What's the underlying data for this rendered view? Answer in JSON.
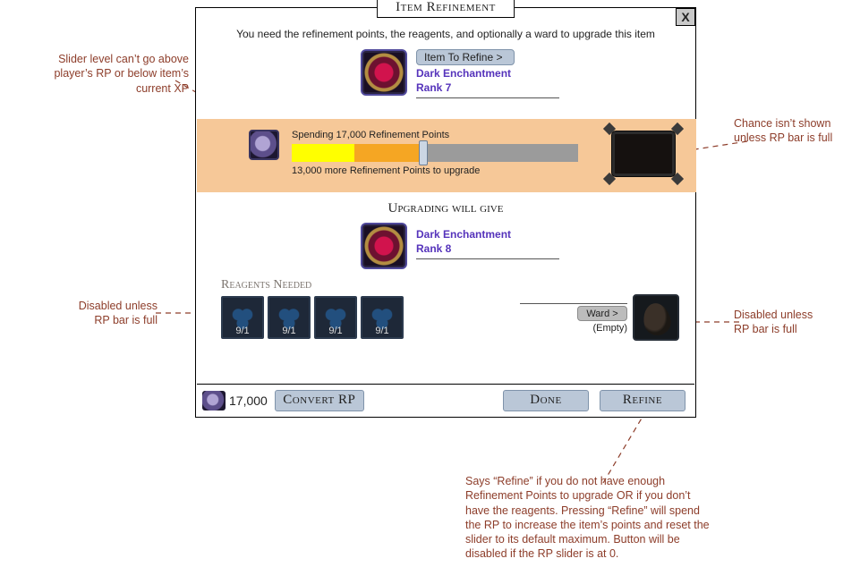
{
  "header": {
    "title": "Item Refinement",
    "close": "X",
    "intro": "You need the refinement points, the reagents, and optionally a ward to upgrade this item"
  },
  "item": {
    "button_label": "Item To Refine >",
    "name": "Dark Enchantment",
    "rank": "Rank 7"
  },
  "slider": {
    "spending_line": "Spending 17,000 Refinement Points",
    "remaining_line": "13,000 more Refinement Points to upgrade"
  },
  "upgrade": {
    "heading": "Upgrading will give",
    "name": "Dark Enchantment",
    "rank": "Rank 8"
  },
  "reagents": {
    "heading": "Reagents Needed",
    "counts": [
      "9/1",
      "9/1",
      "9/1",
      "9/1"
    ]
  },
  "ward": {
    "button_label": "Ward >",
    "empty": "(Empty)"
  },
  "footer": {
    "rp_total": "17,000",
    "convert": "Convert RP",
    "done": "Done",
    "refine": "Refine"
  },
  "annotations": {
    "a1": "Slider level can’t go above player’s RP or below item’s current XP",
    "a2": "Chance isn’t shown unless RP bar is full",
    "a3": "Disabled unless RP bar is full",
    "a4": "Disabled unless RP bar is full",
    "a5": "Says “Refine” if you do not have enough Refinement Points to upgrade OR if you don’t have the reagents. Pressing “Refine” will spend the RP to increase the item’s points and reset the slider to its default maximum. Button will be disabled if the RP slider is at 0."
  }
}
